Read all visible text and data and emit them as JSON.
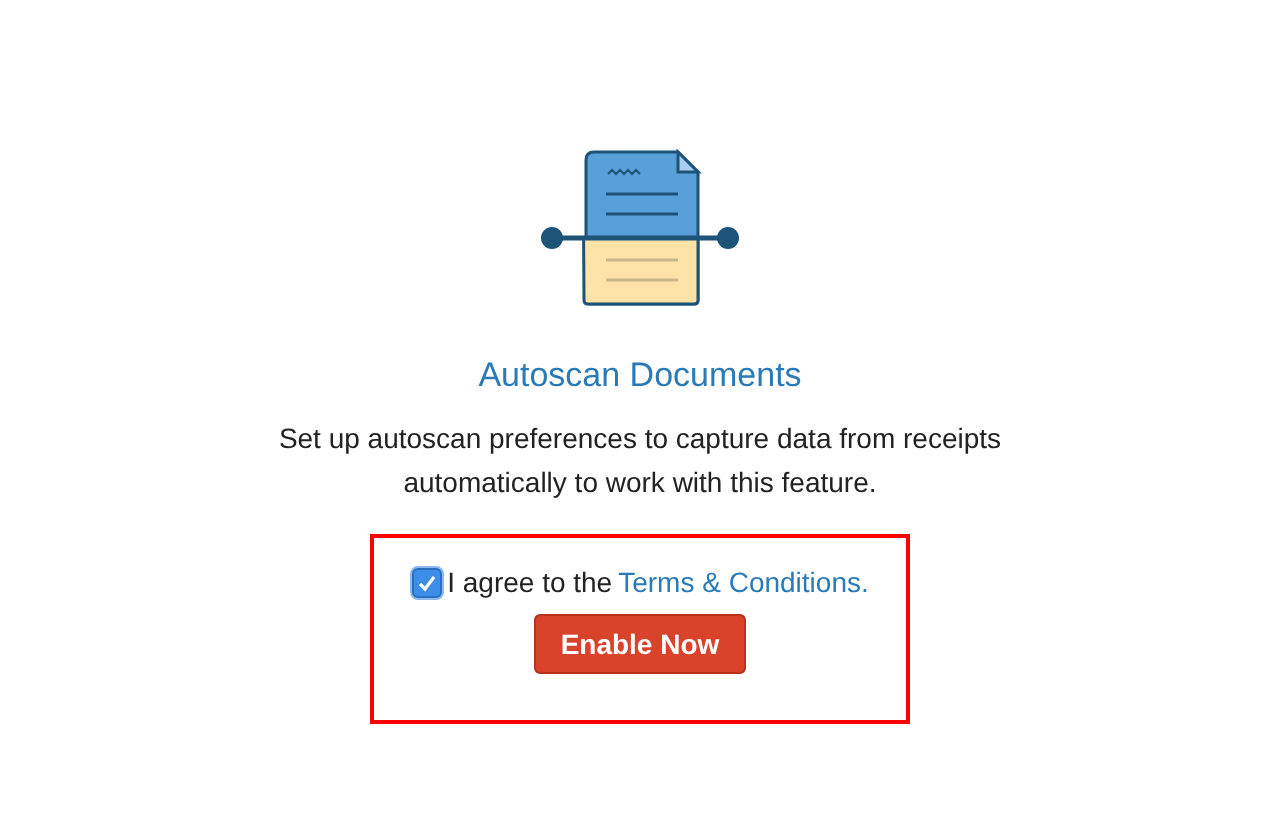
{
  "title": "Autoscan Documents",
  "description": "Set up autoscan preferences to capture data from receipts automatically to work with this feature.",
  "agreement": {
    "checked": true,
    "text": "I agree to the",
    "link": "Terms & Conditions."
  },
  "button": "Enable Now"
}
